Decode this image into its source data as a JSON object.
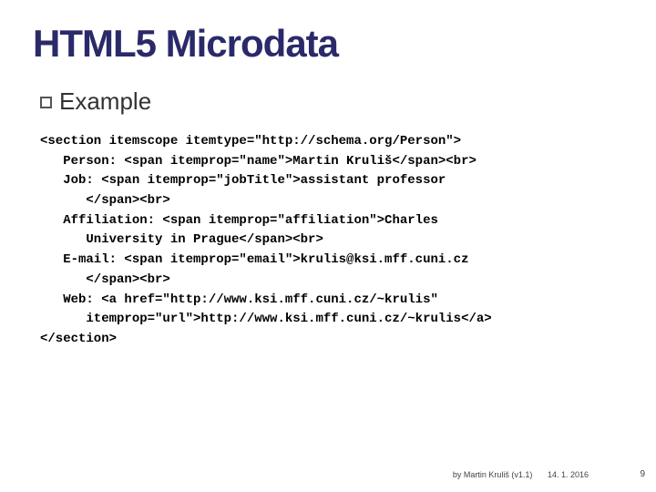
{
  "title": "HTML5 Microdata",
  "subtitle": "Example",
  "code": "<section itemscope itemtype=\"http://schema.org/Person\">\n   Person: <span itemprop=\"name\">Martin Kruliš</span><br>\n   Job: <span itemprop=\"jobTitle\">assistant professor\n      </span><br>\n   Affiliation: <span itemprop=\"affiliation\">Charles\n      University in Prague</span><br>\n   E-mail: <span itemprop=\"email\">krulis@ksi.mff.cuni.cz\n      </span><br>\n   Web: <a href=\"http://www.ksi.mff.cuni.cz/~krulis\"\n      itemprop=\"url\">http://www.ksi.mff.cuni.cz/~krulis</a>\n</section>",
  "footer": {
    "author": "by Martin Kruliš (v1.1)",
    "date": "14. 1. 2016",
    "page": "9"
  }
}
